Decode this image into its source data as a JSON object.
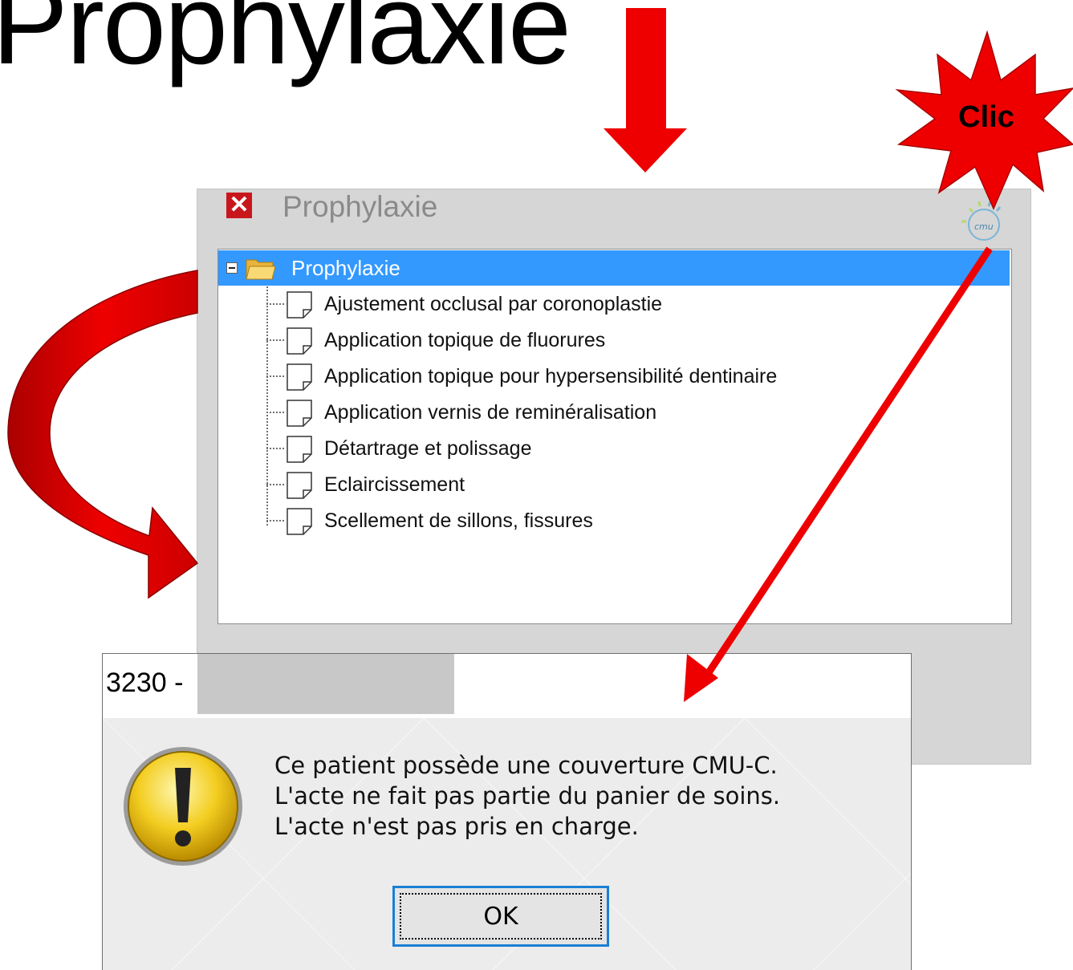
{
  "slide": {
    "title": "Prophylaxie"
  },
  "annotation": {
    "clic_label": "Clic"
  },
  "panel": {
    "title": "Prophylaxie",
    "close_icon": "close-icon",
    "cmu_label": "cmu",
    "tree": {
      "root_label": "Prophylaxie",
      "items": [
        {
          "label": "Ajustement occlusal par coronoplastie"
        },
        {
          "label": "Application topique de fluorures"
        },
        {
          "label": "Application topique pour hypersensibilité dentinaire"
        },
        {
          "label": "Application vernis de reminéralisation"
        },
        {
          "label": "Détartrage et polissage"
        },
        {
          "label": "Eclaircissement"
        },
        {
          "label": "Scellement de sillons, fissures"
        }
      ]
    }
  },
  "dialog": {
    "title": "3230 -",
    "message_lines": [
      "Ce patient possède une couverture CMU-C.",
      "L'acte ne fait pas partie du panier de soins.",
      "L'acte n'est pas pris en charge."
    ],
    "ok_label": "OK"
  },
  "colors": {
    "arrow_red": "#ee0000",
    "selection_blue": "#3399ff",
    "panel_gray": "#d6d6d6",
    "close_red": "#c8171c"
  }
}
